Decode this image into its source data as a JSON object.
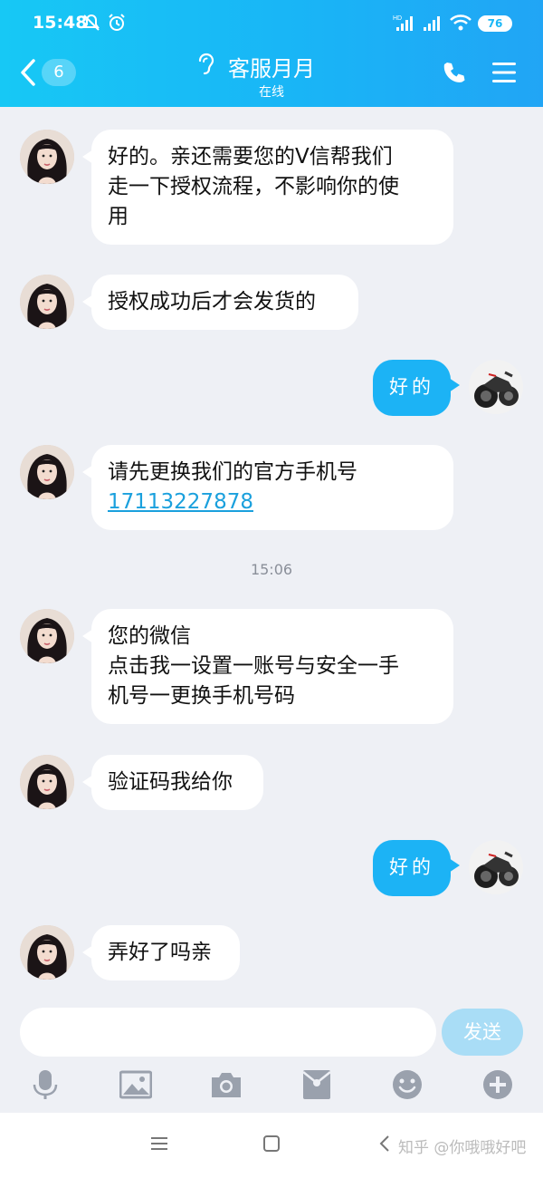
{
  "status_bar": {
    "time": "15:48",
    "battery": "76"
  },
  "header": {
    "back_count": "6",
    "title": "客服月月",
    "subtitle": "在线"
  },
  "messages": [
    {
      "side": "other",
      "text": "好的。亲还需要您的V信帮我们\n走一下授权流程，不影响你的使\n用"
    },
    {
      "side": "other",
      "text": "授权成功后才会发货的"
    },
    {
      "side": "self",
      "text": "好的"
    },
    {
      "side": "other",
      "text": "请先更换我们的官方手机号",
      "link": "17113227878"
    },
    {
      "side": "other",
      "text": "您的微信\n点击我一设置一账号与安全一手\n机号一更换手机号码"
    },
    {
      "side": "other",
      "text": "验证码我给你"
    },
    {
      "side": "self",
      "text": "好的"
    },
    {
      "side": "other",
      "text": "弄好了吗亲"
    }
  ],
  "timestamp": "15:06",
  "input": {
    "value": "",
    "send_label": "发送"
  },
  "toolbar": [
    "microphone-icon",
    "image-icon",
    "camera-icon",
    "red-packet-icon",
    "emoji-icon",
    "plus-icon"
  ],
  "navbar": {
    "watermark": "知乎 @你哦哦好吧"
  },
  "colors": {
    "header_gradient_start": "#17c8f5",
    "header_gradient_end": "#21a5f5",
    "self_bubble": "#1cb3f5",
    "background": "#eef0f5",
    "link": "#1aa0dd"
  }
}
